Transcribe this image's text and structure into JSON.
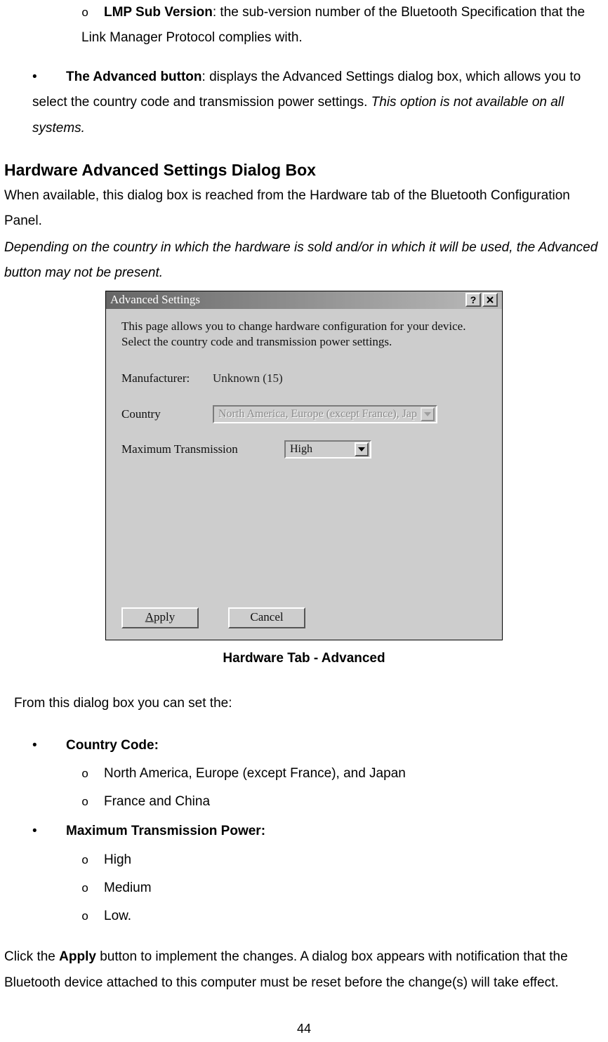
{
  "top": {
    "lmp_label": "LMP Sub Version",
    "lmp_text": ": the sub-version number of the Bluetooth Specification that the Link Manager Protocol complies with.",
    "adv_label": "The Advanced button",
    "adv_text": ": displays the Advanced Settings dialog box, which allows you to select the country code and transmission power settings. ",
    "adv_ital": "This option is not available on all systems."
  },
  "heading": "Hardware Advanced Settings Dialog Box",
  "p1": "When available, this dialog box is reached from the Hardware tab of the Bluetooth Configuration Panel.",
  "p2": "Depending on the country in which the hardware is sold and/or in which it will be used, the Advanced button may not be present.",
  "dialog": {
    "title": "Advanced Settings",
    "desc": "This page allows you to change hardware configuration for your device. Select the country code and transmission power settings.",
    "manufacturer_label": "Manufacturer:",
    "manufacturer_value": "Unknown (15)",
    "country_label": "Country",
    "country_value": "North America, Europe (except France), Japan",
    "maxtrans_label": "Maximum Transmission",
    "maxtrans_value": "High",
    "apply": "Apply",
    "cancel": "Cancel"
  },
  "caption": "Hardware Tab - Advanced",
  "p3": "From this dialog box you can set the:",
  "list": {
    "country_head": "Country Code:",
    "country_opts": [
      "North America, Europe (except France), and Japan",
      "France and China"
    ],
    "maxtrans_head": "Maximum Transmission Power:",
    "maxtrans_opts": [
      "High",
      "Medium",
      "Low."
    ]
  },
  "p4a": "Click the ",
  "p4b": "Apply",
  "p4c": " button to implement the changes. A dialog box appears with notification that the Bluetooth device attached to this computer must be reset before the change(s) will take effect.",
  "page": "44"
}
